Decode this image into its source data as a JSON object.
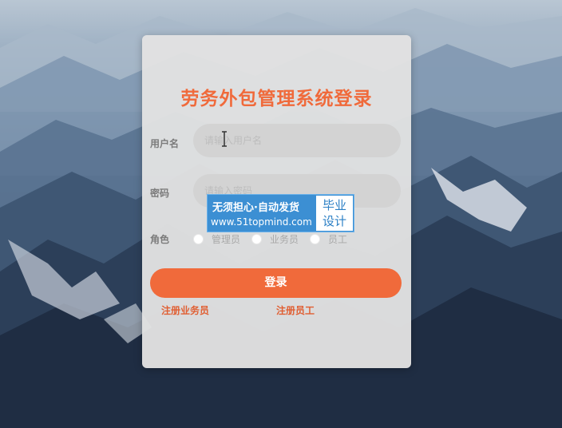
{
  "login": {
    "title": "劳务外包管理系统登录",
    "username_label": "用户名",
    "username_placeholder": "请输入用户名",
    "password_label": "密码",
    "password_placeholder": "请输入密码",
    "role_label": "角色",
    "roles": [
      "管理员",
      "业务员",
      "员工"
    ],
    "login_button": "登录",
    "register_salesman": "注册业务员",
    "register_employee": "注册员工"
  },
  "watermark": {
    "line1": "无须担心·自动发货",
    "line2": "www.51topmind.com",
    "badge_line1": "毕业",
    "badge_line2": "设计"
  },
  "colors": {
    "accent": "#f06a3b",
    "card": "#e2e2e2",
    "input": "#d3d3d3",
    "watermark": "#3c8fd3"
  },
  "icons": [
    "text-cursor-icon",
    "radio-icon"
  ]
}
